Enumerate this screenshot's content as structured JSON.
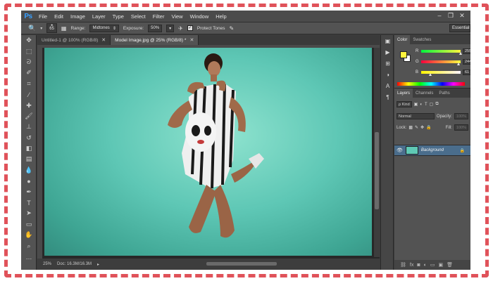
{
  "app": {
    "logo": "Ps",
    "menu": [
      "File",
      "Edit",
      "Image",
      "Layer",
      "Type",
      "Select",
      "Filter",
      "View",
      "Window",
      "Help"
    ],
    "window_controls": [
      "–",
      "❐",
      "✕"
    ]
  },
  "options": {
    "brush_size": "65",
    "range_label": "Range:",
    "range_value": "Midtones",
    "exposure_label": "Exposure:",
    "exposure_value": "50%",
    "protect_tones_label": "Protect Tones",
    "protect_tones_checked": true,
    "workspace": "Essentials"
  },
  "tabs": [
    {
      "label": "Untitled-1 @ 100% (RGB/8)",
      "close": "✕",
      "active": false
    },
    {
      "label": "Model Image.jpg @ 25% (RGB/8) *",
      "close": "✕",
      "active": true
    }
  ],
  "status": {
    "zoom": "25%",
    "doc": "Doc: 16.3M/16.3M"
  },
  "color_panel": {
    "tabs": [
      "Color",
      "Swatches"
    ],
    "foreground": "#fff43d",
    "background": "#ffffff",
    "r_label": "R",
    "r_value": "255",
    "g_label": "G",
    "g_value": "244",
    "b_label": "B",
    "b_value": "61"
  },
  "layers_panel": {
    "tabs": [
      "Layers",
      "Channels",
      "Paths"
    ],
    "filter_kind": "ρ Kind",
    "blend_mode": "Normal",
    "opacity_label": "Opacity:",
    "opacity_value": "100%",
    "lock_label": "Lock:",
    "fill_label": "Fill:",
    "fill_value": "100%",
    "layer_name": "Background"
  },
  "colors": {
    "accent": "#39a0ff",
    "canvas_bg": "#5ec7b5",
    "selected_layer": "#4a6d8c",
    "frame": "#e0525a"
  }
}
